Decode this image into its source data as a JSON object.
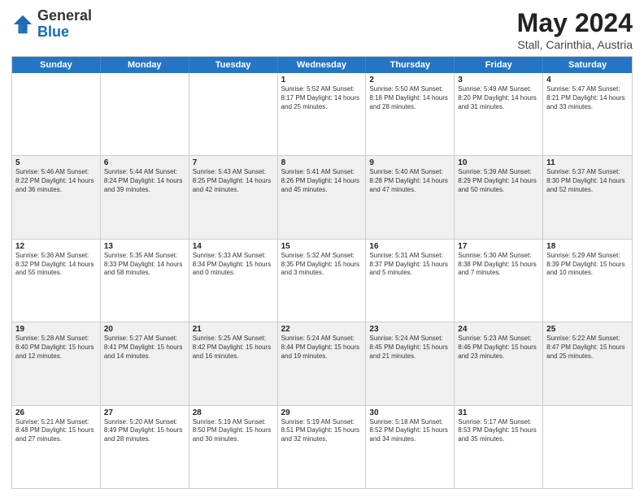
{
  "header": {
    "logo_general": "General",
    "logo_blue": "Blue",
    "month_year": "May 2024",
    "location": "Stall, Carinthia, Austria"
  },
  "days_of_week": [
    "Sunday",
    "Monday",
    "Tuesday",
    "Wednesday",
    "Thursday",
    "Friday",
    "Saturday"
  ],
  "rows": [
    [
      {
        "day": "",
        "info": ""
      },
      {
        "day": "",
        "info": ""
      },
      {
        "day": "",
        "info": ""
      },
      {
        "day": "1",
        "info": "Sunrise: 5:52 AM\nSunset: 8:17 PM\nDaylight: 14 hours\nand 25 minutes."
      },
      {
        "day": "2",
        "info": "Sunrise: 5:50 AM\nSunset: 8:18 PM\nDaylight: 14 hours\nand 28 minutes."
      },
      {
        "day": "3",
        "info": "Sunrise: 5:49 AM\nSunset: 8:20 PM\nDaylight: 14 hours\nand 31 minutes."
      },
      {
        "day": "4",
        "info": "Sunrise: 5:47 AM\nSunset: 8:21 PM\nDaylight: 14 hours\nand 33 minutes."
      }
    ],
    [
      {
        "day": "5",
        "info": "Sunrise: 5:46 AM\nSunset: 8:22 PM\nDaylight: 14 hours\nand 36 minutes."
      },
      {
        "day": "6",
        "info": "Sunrise: 5:44 AM\nSunset: 8:24 PM\nDaylight: 14 hours\nand 39 minutes."
      },
      {
        "day": "7",
        "info": "Sunrise: 5:43 AM\nSunset: 8:25 PM\nDaylight: 14 hours\nand 42 minutes."
      },
      {
        "day": "8",
        "info": "Sunrise: 5:41 AM\nSunset: 8:26 PM\nDaylight: 14 hours\nand 45 minutes."
      },
      {
        "day": "9",
        "info": "Sunrise: 5:40 AM\nSunset: 8:28 PM\nDaylight: 14 hours\nand 47 minutes."
      },
      {
        "day": "10",
        "info": "Sunrise: 5:39 AM\nSunset: 8:29 PM\nDaylight: 14 hours\nand 50 minutes."
      },
      {
        "day": "11",
        "info": "Sunrise: 5:37 AM\nSunset: 8:30 PM\nDaylight: 14 hours\nand 52 minutes."
      }
    ],
    [
      {
        "day": "12",
        "info": "Sunrise: 5:36 AM\nSunset: 8:32 PM\nDaylight: 14 hours\nand 55 minutes."
      },
      {
        "day": "13",
        "info": "Sunrise: 5:35 AM\nSunset: 8:33 PM\nDaylight: 14 hours\nand 58 minutes."
      },
      {
        "day": "14",
        "info": "Sunrise: 5:33 AM\nSunset: 8:34 PM\nDaylight: 15 hours\nand 0 minutes."
      },
      {
        "day": "15",
        "info": "Sunrise: 5:32 AM\nSunset: 8:35 PM\nDaylight: 15 hours\nand 3 minutes."
      },
      {
        "day": "16",
        "info": "Sunrise: 5:31 AM\nSunset: 8:37 PM\nDaylight: 15 hours\nand 5 minutes."
      },
      {
        "day": "17",
        "info": "Sunrise: 5:30 AM\nSunset: 8:38 PM\nDaylight: 15 hours\nand 7 minutes."
      },
      {
        "day": "18",
        "info": "Sunrise: 5:29 AM\nSunset: 8:39 PM\nDaylight: 15 hours\nand 10 minutes."
      }
    ],
    [
      {
        "day": "19",
        "info": "Sunrise: 5:28 AM\nSunset: 8:40 PM\nDaylight: 15 hours\nand 12 minutes."
      },
      {
        "day": "20",
        "info": "Sunrise: 5:27 AM\nSunset: 8:41 PM\nDaylight: 15 hours\nand 14 minutes."
      },
      {
        "day": "21",
        "info": "Sunrise: 5:25 AM\nSunset: 8:42 PM\nDaylight: 15 hours\nand 16 minutes."
      },
      {
        "day": "22",
        "info": "Sunrise: 5:24 AM\nSunset: 8:44 PM\nDaylight: 15 hours\nand 19 minutes."
      },
      {
        "day": "23",
        "info": "Sunrise: 5:24 AM\nSunset: 8:45 PM\nDaylight: 15 hours\nand 21 minutes."
      },
      {
        "day": "24",
        "info": "Sunrise: 5:23 AM\nSunset: 8:46 PM\nDaylight: 15 hours\nand 23 minutes."
      },
      {
        "day": "25",
        "info": "Sunrise: 5:22 AM\nSunset: 8:47 PM\nDaylight: 15 hours\nand 25 minutes."
      }
    ],
    [
      {
        "day": "26",
        "info": "Sunrise: 5:21 AM\nSunset: 8:48 PM\nDaylight: 15 hours\nand 27 minutes."
      },
      {
        "day": "27",
        "info": "Sunrise: 5:20 AM\nSunset: 8:49 PM\nDaylight: 15 hours\nand 28 minutes."
      },
      {
        "day": "28",
        "info": "Sunrise: 5:19 AM\nSunset: 8:50 PM\nDaylight: 15 hours\nand 30 minutes."
      },
      {
        "day": "29",
        "info": "Sunrise: 5:19 AM\nSunset: 8:51 PM\nDaylight: 15 hours\nand 32 minutes."
      },
      {
        "day": "30",
        "info": "Sunrise: 5:18 AM\nSunset: 8:52 PM\nDaylight: 15 hours\nand 34 minutes."
      },
      {
        "day": "31",
        "info": "Sunrise: 5:17 AM\nSunset: 8:53 PM\nDaylight: 15 hours\nand 35 minutes."
      },
      {
        "day": "",
        "info": ""
      }
    ]
  ]
}
